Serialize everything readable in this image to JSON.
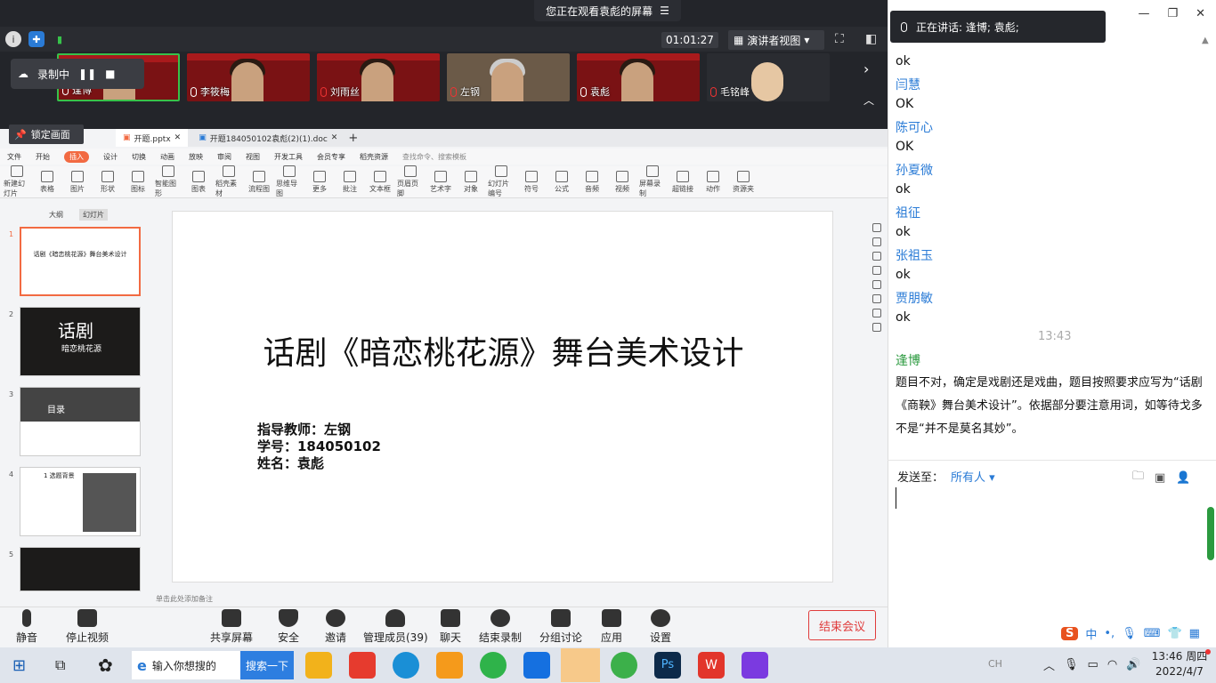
{
  "banner": {
    "text": "您正在观看袁彪的屏幕",
    "menu_icon": "menu-icon"
  },
  "topbar": {
    "timer": "01:01:27",
    "view_label": "演讲者视图"
  },
  "recording": {
    "label": "录制中"
  },
  "lock_label": "锁定画面",
  "participants": [
    {
      "name": "逢博"
    },
    {
      "name": "李筱梅"
    },
    {
      "name": "刘雨丝"
    },
    {
      "name": "左钢"
    },
    {
      "name": "袁彪"
    },
    {
      "name": "毛铭峰"
    }
  ],
  "wps": {
    "tabs": [
      {
        "label": "开题.pptx"
      },
      {
        "label": "开题184050102袁彪(2)(1).doc"
      }
    ],
    "menu": [
      "文件",
      "开始",
      "插入",
      "设计",
      "切换",
      "动画",
      "放映",
      "审阅",
      "视图",
      "开发工具",
      "会员专享",
      "稻壳资源",
      "查找命令、搜索模板"
    ],
    "tools": [
      "新建幻灯片",
      "表格",
      "图片",
      "形状",
      "图标",
      "智能图形",
      "图表",
      "稻壳素材",
      "流程图",
      "思维导图",
      "更多",
      "批注",
      "文本框",
      "页眉页脚",
      "艺术字",
      "对象",
      "幻灯片编号",
      "符号",
      "公式",
      "音频",
      "视频",
      "屏幕录制",
      "超链接",
      "动作",
      "资源夹"
    ],
    "pane_tabs": [
      "大纲",
      "幻灯片"
    ],
    "thumb_titles": [
      "话剧《暗恋桃花源》舞台美术设计",
      "话剧",
      "目录",
      "1 选题背景",
      ""
    ],
    "thumb_sub": "暗恋桃花源",
    "slide": {
      "title": "话剧《暗恋桃花源》舞台美术设计",
      "advisor": "指导教师：左钢",
      "student_id": "学号：184050102",
      "name": "姓名：袁彪"
    },
    "notes_placeholder": "单击此处添加备注"
  },
  "toolbar": {
    "mute": "静音",
    "video": "停止视频",
    "share": "共享屏幕",
    "security": "安全",
    "invite": "邀请",
    "members": "管理成员(39)",
    "chat": "聊天",
    "end_rec": "结束录制",
    "breakout": "分组讨论",
    "apps": "应用",
    "settings": "设置",
    "end_meeting": "结束会议"
  },
  "speaking": {
    "text": "正在讲话: 逢博; 袁彪;"
  },
  "chat": {
    "messages": [
      {
        "text": "ok"
      },
      {
        "name": "闫慧",
        "text": "OK"
      },
      {
        "name": "陈可心",
        "text": "OK"
      },
      {
        "name": "孙夏微",
        "text": "ok"
      },
      {
        "name": "祖征",
        "text": "ok"
      },
      {
        "name": "张祖玉",
        "text": "ok"
      },
      {
        "name": "贾朋敏",
        "text": "ok"
      }
    ],
    "time": "13:43",
    "last_name": "逢博",
    "last_text": "题目不对，确定是戏剧还是戏曲，题目按照要求应写为“话剧《商鞅》舞台美术设计”。依据部分要注意用词，如等待戈多不是“并不是莫名其妙”。",
    "send_to_label": "发送至：",
    "send_to_value": "所有人"
  },
  "taskbar": {
    "search_placeholder": "输入你想搜的",
    "search_button": "搜索一下",
    "ime_lang": "CH",
    "ime_label": "中",
    "time": "13:46 周四",
    "date": "2022/4/7"
  },
  "colors": {
    "accent": "#2a7bd6",
    "end": "#e03c3c",
    "wps_orange": "#f26a42"
  }
}
